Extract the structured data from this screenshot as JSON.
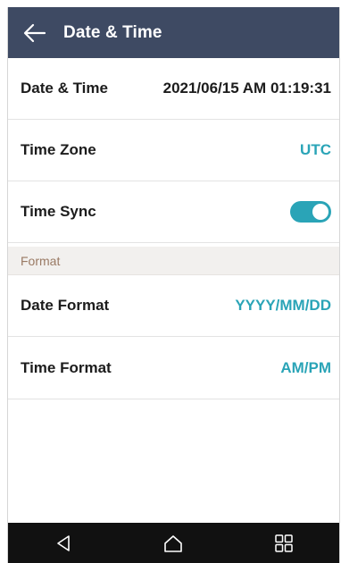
{
  "header": {
    "title": "Date & Time",
    "back_icon": "arrow-left-icon",
    "bg_color": "#3e4a63"
  },
  "settings": {
    "date_time": {
      "label": "Date & Time",
      "value": "2021/06/15 AM 01:19:31"
    },
    "time_zone": {
      "label": "Time Zone",
      "value": "UTC"
    },
    "time_sync": {
      "label": "Time Sync",
      "enabled": true
    }
  },
  "format_section": {
    "title": "Format",
    "date_format": {
      "label": "Date Format",
      "value": "YYYY/MM/DD"
    },
    "time_format": {
      "label": "Time Format",
      "value": "AM/PM"
    }
  },
  "navbar": {
    "icons": [
      "back-triangle-icon",
      "home-icon",
      "recents-icon"
    ]
  },
  "colors": {
    "accent": "#2aa4b7",
    "section_text": "#9a7a64",
    "section_bg": "#f2f0ee"
  }
}
